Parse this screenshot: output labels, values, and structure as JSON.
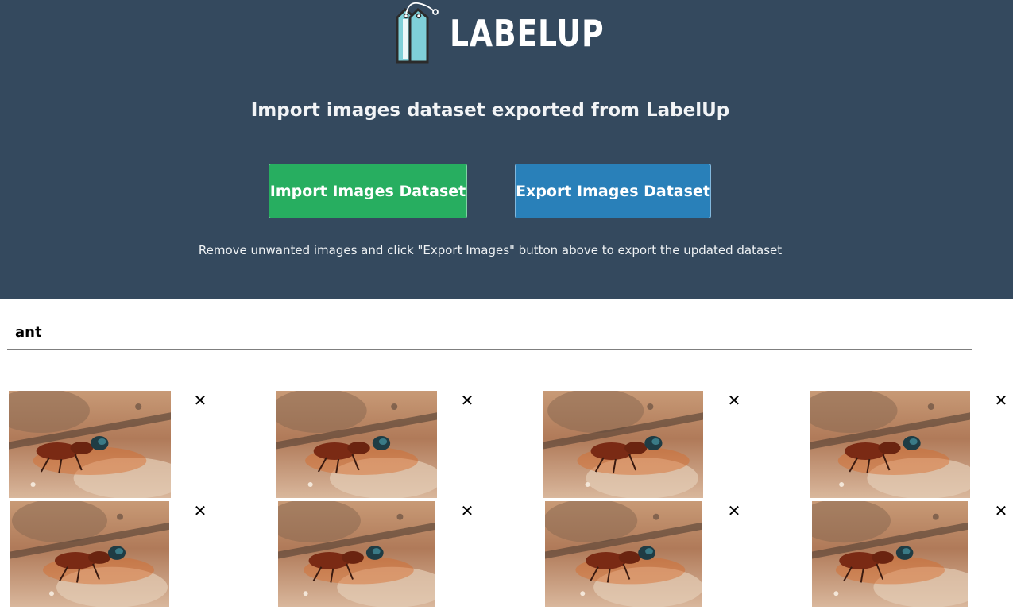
{
  "header": {
    "logo_text": "LABELUP",
    "subtitle": "Import images dataset exported from LabelUp",
    "import_button": "Import Images Dataset",
    "export_button": "Export Images Dataset",
    "hint": "Remove unwanted images and click \"Export Images\" button above to export the updated dataset"
  },
  "dataset": {
    "label": "ant",
    "remove_symbol": "✕",
    "images": [
      {
        "icon": "ant-photo"
      },
      {
        "icon": "ant-photo"
      },
      {
        "icon": "ant-photo"
      },
      {
        "icon": "ant-photo"
      },
      {
        "icon": "ant-photo"
      },
      {
        "icon": "ant-photo"
      },
      {
        "icon": "ant-photo"
      },
      {
        "icon": "ant-photo"
      }
    ]
  },
  "colors": {
    "header_bg": "#34495e",
    "import_green": "#27ae60",
    "export_blue": "#2980b9",
    "logo_cyan": "#7fd0d8"
  }
}
